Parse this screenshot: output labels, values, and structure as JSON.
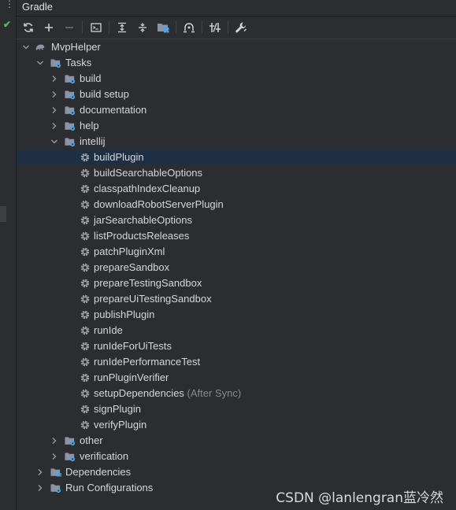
{
  "panel": {
    "title": "Gradle"
  },
  "toolbar": {
    "buttons": [
      {
        "icon": "refresh-icon"
      },
      {
        "icon": "add-icon"
      },
      {
        "icon": "remove-icon"
      },
      {
        "icon": "execute-task-icon"
      },
      {
        "icon": "expand-all-icon"
      },
      {
        "icon": "collapse-all-icon"
      },
      {
        "icon": "group-modules-icon"
      },
      {
        "icon": "offline-mode-icon"
      },
      {
        "icon": "toggle-skip-tests-icon"
      },
      {
        "icon": "build-settings-icon"
      }
    ]
  },
  "tree": {
    "root": "MvpHelper",
    "tasks": "Tasks",
    "groups": {
      "build": "build",
      "build_setup": "build setup",
      "documentation": "documentation",
      "help": "help",
      "intellij": "intellij",
      "other": "other",
      "verification": "verification"
    },
    "intellij_tasks": [
      "buildPlugin",
      "buildSearchableOptions",
      "classpathIndexCleanup",
      "downloadRobotServerPlugin",
      "jarSearchableOptions",
      "listProductsReleases",
      "patchPluginXml",
      "prepareSandbox",
      "prepareTestingSandbox",
      "prepareUiTestingSandbox",
      "publishPlugin",
      "runIde",
      "runIdeForUiTests",
      "runIdePerformanceTest",
      "runPluginVerifier",
      "setupDependencies",
      "signPlugin",
      "verifyPlugin"
    ],
    "setup_hint": "(After Sync)",
    "dependencies": "Dependencies",
    "run_configurations": "Run Configurations",
    "selected": "buildPlugin"
  },
  "watermark": "CSDN @lanlengran蓝冷然",
  "colors": {
    "background": "#2b2d30",
    "selection": "#1e2f44",
    "text": "#d5d7da",
    "hint": "#868a91",
    "icon": "#9da0a8",
    "gradle_badge": "#4fa6e8"
  }
}
